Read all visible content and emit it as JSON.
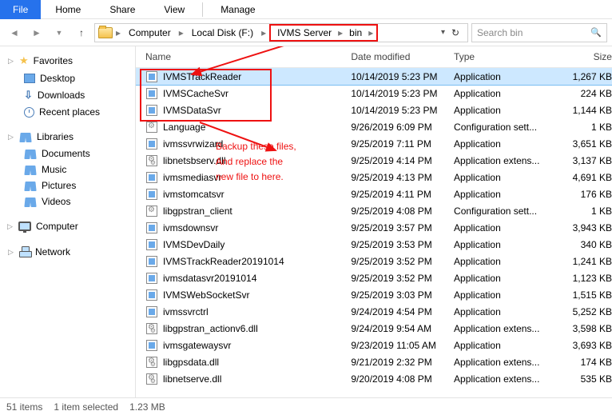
{
  "tabs": {
    "file": "File",
    "home": "Home",
    "share": "Share",
    "view": "View",
    "manage": "Manage"
  },
  "breadcrumb": [
    "Computer",
    "Local Disk (F:)",
    "IVMS Server",
    "bin"
  ],
  "search_placeholder": "Search bin",
  "sidebar": {
    "favorites": {
      "label": "Favorites",
      "items": [
        "Desktop",
        "Downloads",
        "Recent places"
      ]
    },
    "libraries": {
      "label": "Libraries",
      "items": [
        "Documents",
        "Music",
        "Pictures",
        "Videos"
      ]
    },
    "computer": {
      "label": "Computer"
    },
    "network": {
      "label": "Network"
    }
  },
  "columns": {
    "name": "Name",
    "date": "Date modified",
    "type": "Type",
    "size": "Size"
  },
  "files": [
    {
      "name": "IVMSTrackReader",
      "date": "10/14/2019 5:23 PM",
      "type": "Application",
      "size": "1,267 KB",
      "icon": "exe",
      "sel": true
    },
    {
      "name": "IVMSCacheSvr",
      "date": "10/14/2019 5:23 PM",
      "type": "Application",
      "size": "224 KB",
      "icon": "exe"
    },
    {
      "name": "IVMSDataSvr",
      "date": "10/14/2019 5:23 PM",
      "type": "Application",
      "size": "1,144 KB",
      "icon": "exe"
    },
    {
      "name": "Language",
      "date": "9/26/2019 6:09 PM",
      "type": "Configuration sett...",
      "size": "1 KB",
      "icon": "cfg"
    },
    {
      "name": "ivmssvrwizard",
      "date": "9/25/2019 7:11 PM",
      "type": "Application",
      "size": "3,651 KB",
      "icon": "exe"
    },
    {
      "name": "libnetsbserv.dll",
      "date": "9/25/2019 4:14 PM",
      "type": "Application extens...",
      "size": "3,137 KB",
      "icon": "dll"
    },
    {
      "name": "ivmsmediasvr",
      "date": "9/25/2019 4:13 PM",
      "type": "Application",
      "size": "4,691 KB",
      "icon": "exe"
    },
    {
      "name": "ivmstomcatsvr",
      "date": "9/25/2019 4:11 PM",
      "type": "Application",
      "size": "176 KB",
      "icon": "exe"
    },
    {
      "name": "libgpstran_client",
      "date": "9/25/2019 4:08 PM",
      "type": "Configuration sett...",
      "size": "1 KB",
      "icon": "cfg"
    },
    {
      "name": "ivmsdownsvr",
      "date": "9/25/2019 3:57 PM",
      "type": "Application",
      "size": "3,943 KB",
      "icon": "exe"
    },
    {
      "name": "IVMSDevDaily",
      "date": "9/25/2019 3:53 PM",
      "type": "Application",
      "size": "340 KB",
      "icon": "exe"
    },
    {
      "name": "IVMSTrackReader20191014",
      "date": "9/25/2019 3:52 PM",
      "type": "Application",
      "size": "1,241 KB",
      "icon": "exe"
    },
    {
      "name": "ivmsdatasvr20191014",
      "date": "9/25/2019 3:52 PM",
      "type": "Application",
      "size": "1,123 KB",
      "icon": "exe"
    },
    {
      "name": "IVMSWebSocketSvr",
      "date": "9/25/2019 3:03 PM",
      "type": "Application",
      "size": "1,515 KB",
      "icon": "exe"
    },
    {
      "name": "ivmssvrctrl",
      "date": "9/24/2019 4:54 PM",
      "type": "Application",
      "size": "5,252 KB",
      "icon": "exe"
    },
    {
      "name": "libgpstran_actionv6.dll",
      "date": "9/24/2019 9:54 AM",
      "type": "Application extens...",
      "size": "3,598 KB",
      "icon": "dll"
    },
    {
      "name": "ivmsgatewaysvr",
      "date": "9/23/2019 11:05 AM",
      "type": "Application",
      "size": "3,693 KB",
      "icon": "exe"
    },
    {
      "name": "libgpsdata.dll",
      "date": "9/21/2019 2:32 PM",
      "type": "Application extens...",
      "size": "174 KB",
      "icon": "dll"
    },
    {
      "name": "libnetserve.dll",
      "date": "9/20/2019 4:08 PM",
      "type": "Application extens...",
      "size": "535 KB",
      "icon": "dll"
    }
  ],
  "status": {
    "items": "51 items",
    "selected": "1 item selected",
    "size": "1.23 MB"
  },
  "annotations": {
    "line1": "Backup these files,",
    "line2": "And replace the",
    "line3": "new file to here."
  }
}
